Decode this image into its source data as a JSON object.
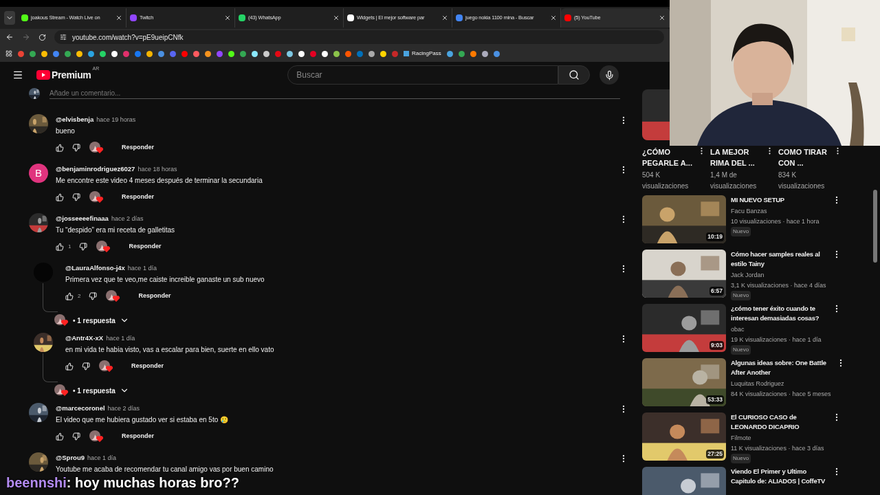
{
  "browser": {
    "tabs": [
      {
        "title": "joakous Stream - Watch Live on",
        "selected": false
      },
      {
        "title": "Twitch",
        "selected": false
      },
      {
        "title": "(43) WhatsApp",
        "selected": false
      },
      {
        "title": "Widgets | El mejor software par",
        "selected": false
      },
      {
        "title": "juego nokia 1100 mina - Buscar",
        "selected": false
      },
      {
        "title": "(5) YouTube",
        "selected": true
      }
    ],
    "url": "youtube.com/watch?v=pE9ueipCNfk",
    "bookmarks": [
      {
        "label": "RacingPass"
      }
    ]
  },
  "header": {
    "logo": "Premium",
    "region": "AR",
    "search": {
      "placeholder": "Buscar"
    }
  },
  "comment_box": {
    "placeholder": "Añade un comentario..."
  },
  "comments": [
    {
      "author": "@elvisbenja",
      "time": "hace 19 horas",
      "text": "bueno",
      "reply_label": "Responder"
    },
    {
      "author": "@benjaminrodriguez6027",
      "time": "hace 18 horas",
      "text": "Me encontre este video 4 meses después de terminar la secundaria",
      "reply_label": "Responder",
      "avatar": {
        "kind": "letter",
        "letter": "B",
        "color": "#e0347e"
      }
    },
    {
      "author": "@josseeeefinaaa",
      "time": "hace 2 días",
      "text": "Tu “despido” era mi receta de galletitas",
      "likes": "1",
      "reply_label": "Responder"
    },
    {
      "author": "@LauraAlfonso-j4x",
      "time": "hace 1 día",
      "text": "Primera vez que te veo,me caiste increible ganaste un sub nuevo",
      "likes": "2",
      "reply_label": "Responder",
      "replies": "• 1 respuesta",
      "avatar": {
        "kind": "blank"
      }
    },
    {
      "author": "@Antr4X-xX",
      "time": "hace 1 día",
      "text": "en mi vida te habia visto, vas a escalar para bien, suerte en ello vato",
      "reply_label": "Responder",
      "replies": "• 1 respuesta"
    },
    {
      "author": "@marcecoronel",
      "time": "hace 2 días",
      "text": "El video que me hubiera gustado ver si estaba en 5to 🥲",
      "reply_label": "Responder"
    },
    {
      "author": "@Sprou9",
      "time": "hace 1 día",
      "text": "Youtube me acaba de recomendar tu canal amigo vas por buen camino"
    }
  ],
  "shorts": [
    {
      "title": "¿CÓMO PEGARLE A...",
      "views": "504 K visualizaciones"
    },
    {
      "title": "LA MEJOR RIMA DEL ...",
      "views": "1,4 M de visualizaciones"
    },
    {
      "title": "COMO TIRAR CON ...",
      "views": "834 K visualizaciones"
    }
  ],
  "videos": [
    {
      "title": "MI NUEVO SETUP",
      "channel": "Facu Banzas",
      "meta": "10 visualizaciones · hace 1 hora",
      "badge": "Nuevo",
      "duration": "10:19"
    },
    {
      "title": "Cómo hacer samples reales al estilo Tainy",
      "channel": "Jack Jordan",
      "meta": "3,1 K visualizaciones · hace 4 días",
      "badge": "Nuevo",
      "duration": "6:57"
    },
    {
      "title": "¿cómo tener éxito cuando te interesan demasiadas cosas?",
      "channel": "obac",
      "meta": "19 K visualizaciones · hace 1 día",
      "badge": "Nuevo",
      "duration": "9:03"
    },
    {
      "title": "Algunas ideas sobre: One Battle After Another",
      "channel": "Luquitas Rodriguez",
      "meta": "84 K visualizaciones · hace 5 meses",
      "duration": "53:33"
    },
    {
      "title": "El CURIOSO CASO de LEONARDO DICAPRIO",
      "channel": "Filmote",
      "meta": "11 K visualizaciones · hace 3 días",
      "badge": "Nuevo",
      "duration": "27:25"
    },
    {
      "title": "Viendo El Primer y Ultimo Capitulo de: ALIADOS | CoffeTV"
    }
  ],
  "chat_overlay": {
    "user": "beennshi",
    "message": ": hoy muchas horas bro??"
  }
}
